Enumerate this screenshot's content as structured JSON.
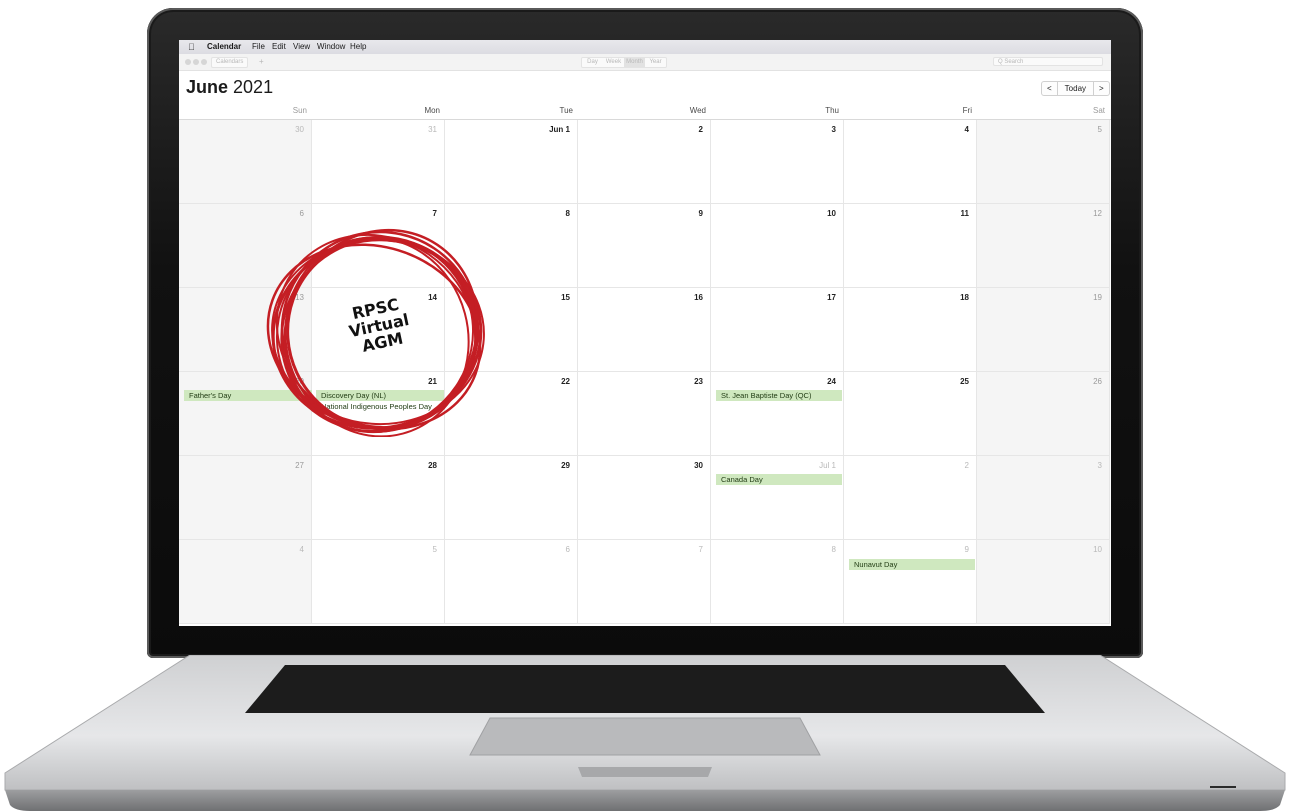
{
  "menubar": {
    "app": "Calendar",
    "items": [
      "File",
      "Edit",
      "View",
      "Window",
      "Help"
    ]
  },
  "toolbar": {
    "calendars_label": "Calendars",
    "add_label": "+",
    "views": [
      "Day",
      "Week",
      "Month",
      "Year"
    ],
    "active_view": "Month",
    "search_placeholder": "Q Search"
  },
  "header": {
    "month": "June",
    "year": "2021",
    "prev": "<",
    "today": "Today",
    "next": ">"
  },
  "weekdays": [
    "Sun",
    "Mon",
    "Tue",
    "Wed",
    "Thu",
    "Fri",
    "Sat"
  ],
  "weeks": [
    [
      "30",
      "31",
      "Jun 1",
      "2",
      "3",
      "4",
      "5"
    ],
    [
      "6",
      "7",
      "8",
      "9",
      "10",
      "11",
      "12"
    ],
    [
      "13",
      "14",
      "15",
      "16",
      "17",
      "18",
      "19"
    ],
    [
      "20",
      "21",
      "22",
      "23",
      "24",
      "25",
      "26"
    ],
    [
      "27",
      "28",
      "29",
      "30",
      "Jul 1",
      "2",
      "3"
    ],
    [
      "4",
      "5",
      "6",
      "7",
      "8",
      "9",
      "10"
    ]
  ],
  "events": {
    "fathers_day": "Father's Day",
    "discovery_day": "Discovery Day (NL)",
    "indigenous_day": "National Indigenous Peoples Day",
    "st_jean": "St. Jean Baptiste Day (QC)",
    "canada_day": "Canada Day",
    "nunavut_day": "Nunavut Day"
  },
  "annotation": {
    "line1": "RPSC",
    "line2": "Virtual",
    "line3": "AGM",
    "color": "#c41e24"
  }
}
